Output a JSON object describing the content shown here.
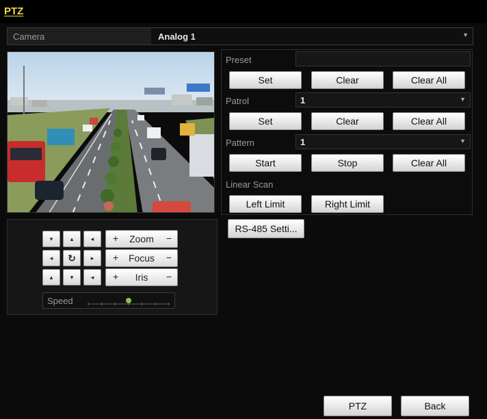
{
  "window": {
    "title": "PTZ"
  },
  "camera": {
    "label": "Camera",
    "value": "Analog 1"
  },
  "ptz_controls": {
    "zoom_label": "Zoom",
    "focus_label": "Focus",
    "iris_label": "Iris",
    "plus": "+",
    "minus": "−",
    "speed_label": "Speed",
    "speed_level": 0.5
  },
  "preset": {
    "label": "Preset",
    "value": "",
    "set": "Set",
    "clear": "Clear",
    "clear_all": "Clear All"
  },
  "patrol": {
    "label": "Patrol",
    "value": "1",
    "set": "Set",
    "clear": "Clear",
    "clear_all": "Clear All"
  },
  "pattern": {
    "label": "Pattern",
    "value": "1",
    "start": "Start",
    "stop": "Stop",
    "clear_all": "Clear All"
  },
  "linear_scan": {
    "label": "Linear Scan",
    "left_limit": "Left Limit",
    "right_limit": "Right Limit"
  },
  "rs485": {
    "label": "RS-485 Setti..."
  },
  "footer": {
    "ptz": "PTZ",
    "back": "Back"
  },
  "colors": {
    "title": "#f2d64b",
    "background": "#0b0b0b",
    "button": "#e6e6e6"
  }
}
